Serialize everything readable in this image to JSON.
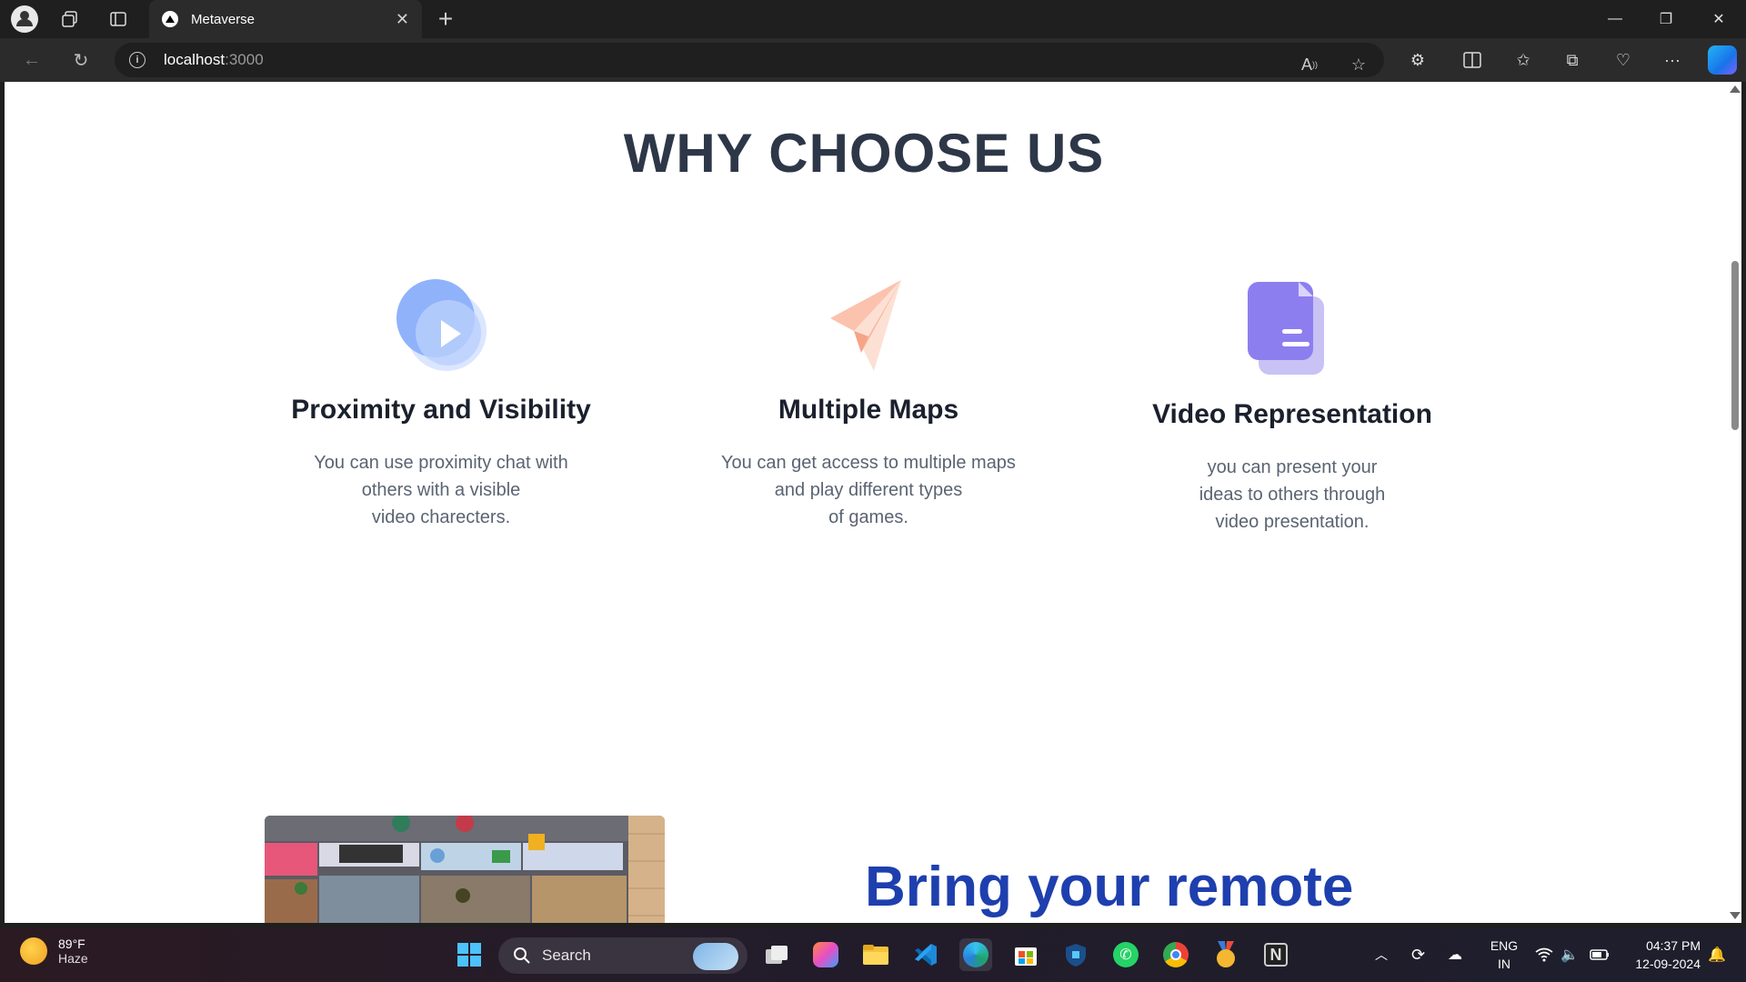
{
  "browser": {
    "tab_title": "Metaverse",
    "address": {
      "host": "localhost",
      "port": ":3000"
    }
  },
  "page": {
    "heading": "WHY CHOOSE US",
    "features": [
      {
        "title": "Proximity and Visibility",
        "description": "You can use proximity chat with\nothers with a visible\nvideo charecters."
      },
      {
        "title": "Multiple Maps",
        "description": "You can get access to multiple maps\nand play different types\nof games."
      },
      {
        "title": "Video Representation",
        "description": "you can present your\nideas to others through\nvideo presentation."
      }
    ],
    "tagline": "Bring your remote"
  },
  "taskbar": {
    "weather": {
      "temp": "89°F",
      "condition": "Haze"
    },
    "search_label": "Search",
    "language": {
      "line1": "ENG",
      "line2": "IN"
    },
    "clock": {
      "time": "04:37 PM",
      "date": "12-09-2024"
    }
  },
  "colors": {
    "heading": "#2d3748",
    "tagline": "#1e3fae",
    "chrome_bg": "#1f1f1f"
  }
}
